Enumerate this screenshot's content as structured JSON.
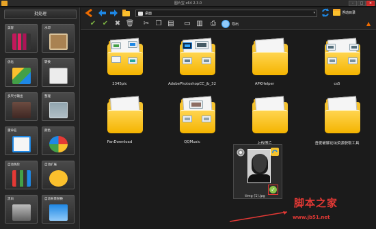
{
  "window": {
    "title": "图片宝 x64 2.3.0"
  },
  "sidebar": {
    "title": "批处理",
    "items": [
      {
        "label": "美容",
        "icon": "cosmetics-icon"
      },
      {
        "label": "水印",
        "icon": "watermark-icon"
      },
      {
        "label": "优化",
        "icon": "optimize-icon"
      },
      {
        "label": "转换",
        "icon": "convert-icon"
      },
      {
        "label": "多尺寸输出",
        "icon": "multi-size-icon"
      },
      {
        "label": "整理",
        "icon": "organize-icon"
      },
      {
        "label": "重命名",
        "icon": "rename-icon"
      },
      {
        "label": "颜色",
        "icon": "color-icon"
      },
      {
        "label": "自动色阶",
        "icon": "auto-levels-icon"
      },
      {
        "label": "自动扩展",
        "icon": "auto-expand-icon"
      },
      {
        "label": "黑白",
        "icon": "black-white-icon"
      },
      {
        "label": "自动背景替换",
        "icon": "background-replace-icon"
      }
    ]
  },
  "toolbar": {
    "path": "桌面",
    "folder_tree_label": "浮动目录",
    "export_label": "导出"
  },
  "folders": [
    {
      "name": "2345pic"
    },
    {
      "name": "AdobePhotoshopCC_jb_32"
    },
    {
      "name": "APKHelper"
    },
    {
      "name": "cs5"
    },
    {
      "name": "PanDownload"
    },
    {
      "name": "QQMusic"
    },
    {
      "name": "上传图片"
    },
    {
      "name": "吾爱破解论坛资源获取工具"
    }
  ],
  "image_card": {
    "name": "timg (1).jpg"
  },
  "watermark": {
    "title": "脚本之家",
    "url": "www.jb51.net"
  },
  "colors": {
    "accent": "#e53935",
    "folder": "#f6c32e",
    "check": "#8bc34a"
  }
}
